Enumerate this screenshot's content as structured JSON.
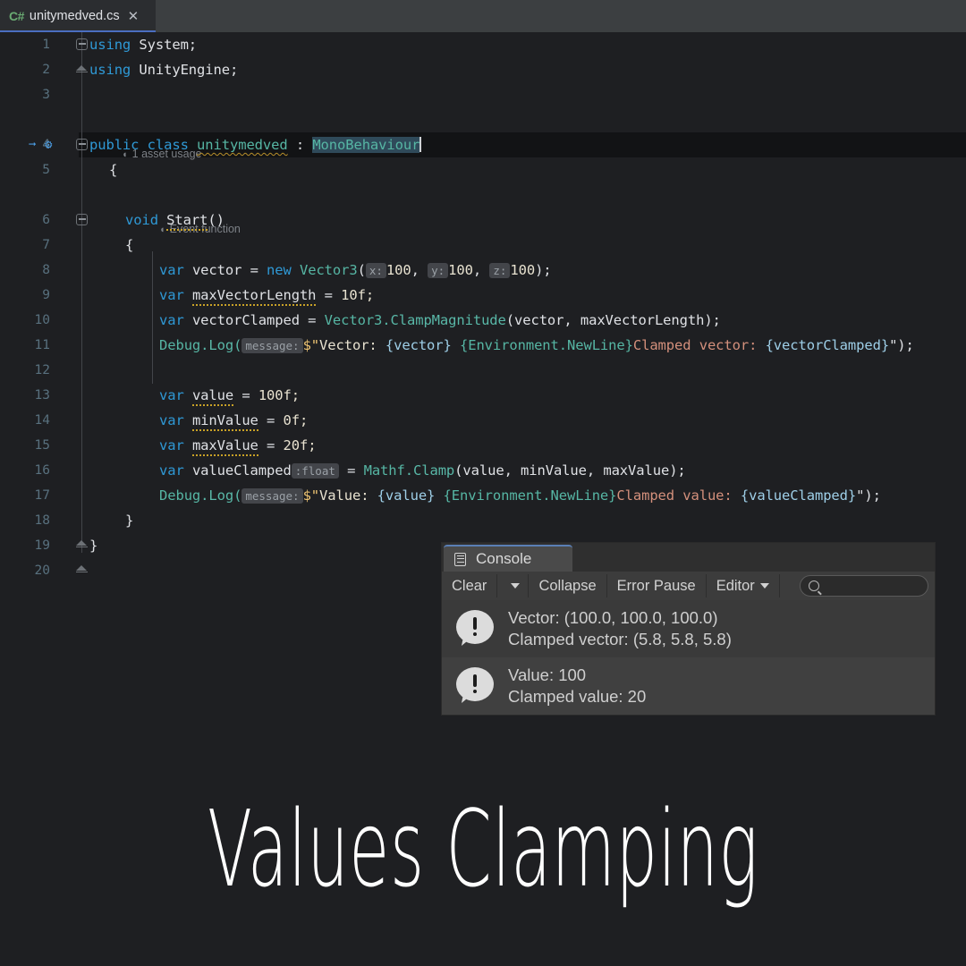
{
  "tab": {
    "lang_badge": "C#",
    "filename": "unitymedved.cs",
    "close": "✕"
  },
  "editor": {
    "line_numbers": [
      "1",
      "2",
      "3",
      "4",
      "5",
      "6",
      "7",
      "8",
      "9",
      "10",
      "11",
      "12",
      "13",
      "14",
      "15",
      "16",
      "17",
      "18",
      "19",
      "20"
    ],
    "codelens": [
      {
        "line": 4,
        "text": "1 asset usage"
      },
      {
        "line": 6,
        "text": "Event function"
      }
    ],
    "code": {
      "l1_using": "using",
      "l1_ns": " System;",
      "l2_using": "using",
      "l2_ns": " UnityEngine;",
      "l4_public": "public",
      "l4_class": "class",
      "l4_name": "unitymedved",
      "l4_colon": ":",
      "l4_base": "MonoBehaviour",
      "l5_brace": "{",
      "l6_void": "void",
      "l6_name": "Start",
      "l6_parens": "()",
      "l7_brace": "{",
      "l8_var": "var",
      "l8_name": "vector",
      "l8_eq": "=",
      "l8_new": "new",
      "l8_type": "Vector3",
      "l8_hx": "x:",
      "l8_vx": "100",
      "l8_hy": "y:",
      "l8_vy": "100",
      "l8_hz": "z:",
      "l8_vz": "100",
      "l9_var": "var",
      "l9_name": "maxVectorLength",
      "l9_val": "10f;",
      "l10_var": "var",
      "l10_name": "vectorClamped",
      "l10_type": "Vector3",
      "l10_method": ".ClampMagnitude",
      "l10_args": "(vector, maxVectorLength);",
      "l11_debug": "Debug",
      "l11_log": ".Log(",
      "l11_hint": "message:",
      "l11_dollar": "$\"",
      "l11_s1": "Vector: ",
      "l11_i1": "{vector}",
      "l11_sp": " ",
      "l11_i2": "{Environment.NewLine}",
      "l11_s2": "Clamped vector: ",
      "l11_i3": "{vectorClamped}",
      "l11_end": "\");",
      "l13_var": "var",
      "l13_name": "value",
      "l13_val": "100f;",
      "l14_var": "var",
      "l14_name": "minValue",
      "l14_val": "0f;",
      "l15_var": "var",
      "l15_name": "maxValue",
      "l15_val": "20f;",
      "l16_var": "var",
      "l16_name": "valueClamped",
      "l16_hint": ":float",
      "l16_type": "Mathf",
      "l16_method": ".Clamp",
      "l16_args": "(value, minValue, maxValue);",
      "l17_debug": "Debug",
      "l17_log": ".Log(",
      "l17_hint": "message:",
      "l17_dollar": "$\"",
      "l17_s1": "Value: ",
      "l17_i1": "{value}",
      "l17_sp": " ",
      "l17_i2": "{Environment.NewLine}",
      "l17_s2": "Clamped value: ",
      "l17_i3": "{valueClamped}",
      "l17_end": "\");",
      "l18_brace": "}",
      "l19_brace": "}"
    }
  },
  "console": {
    "tab_label": "Console",
    "toolbar": {
      "clear": "Clear",
      "collapse": "Collapse",
      "error_pause": "Error Pause",
      "editor": "Editor",
      "search_placeholder": ""
    },
    "entries": [
      {
        "line1": "Vector: (100.0, 100.0, 100.0)",
        "line2": "Clamped vector: (5.8, 5.8, 5.8)"
      },
      {
        "line1": "Value: 100",
        "line2": "Clamped value: 20"
      }
    ]
  },
  "overlay": {
    "title": "Values Clamping"
  },
  "colors": {
    "editor_bg": "#1e1f22",
    "tabbar_bg": "#3c3f41",
    "tab_active_bg": "#2b2d30",
    "tab_underline": "#4a6ec0",
    "keyword": "#2f99d6",
    "type": "#56b6a4",
    "string": "#e8e2d0",
    "interp": "#9ecfe8",
    "linenum": "#58707e",
    "console_bg": "#383838",
    "console_toolbar": "#3c3c3c"
  }
}
